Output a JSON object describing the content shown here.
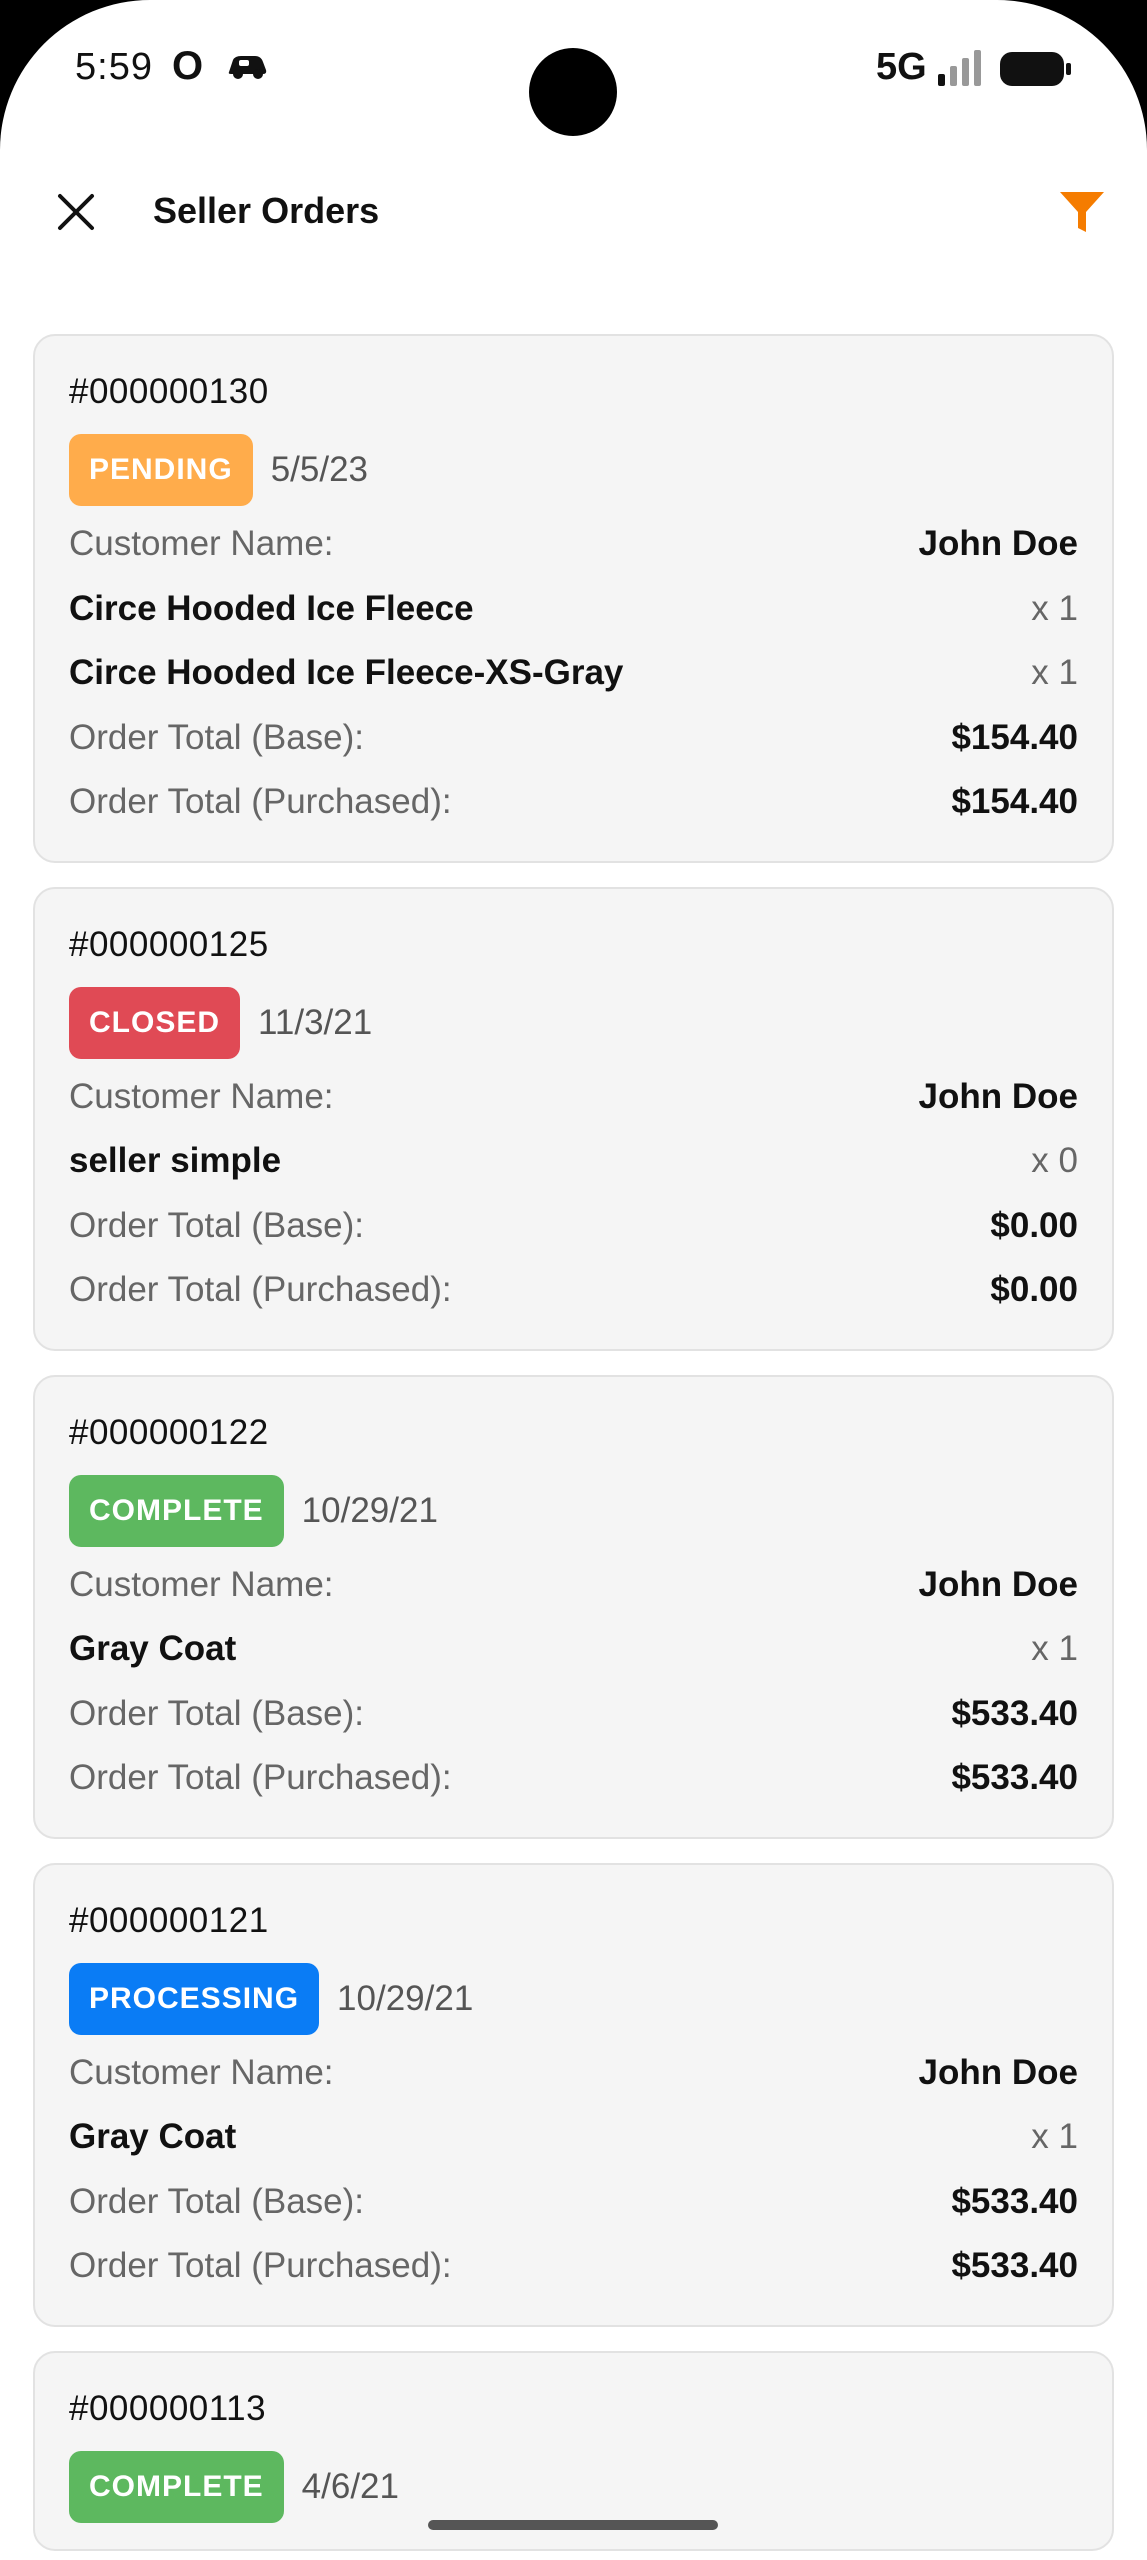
{
  "status_bar": {
    "time": "5:59",
    "app_icon": "O",
    "network": "5G",
    "icons": [
      "car-icon",
      "signal-icon",
      "battery-icon"
    ]
  },
  "app_bar": {
    "title": "Seller Orders",
    "close_icon": "close-icon",
    "filter_icon": "filter-icon",
    "filter_color": "#F57C00"
  },
  "labels": {
    "customer_name": "Customer Name:",
    "total_base": "Order Total (Base):",
    "total_purchased": "Order Total (Purchased):"
  },
  "status_colors": {
    "PENDING": "#FFAC4B",
    "CLOSED": "#E04A55",
    "COMPLETE": "#5DB85F",
    "PROCESSING": "#0A7CF5"
  },
  "orders": [
    {
      "number": "#000000130",
      "status": "PENDING",
      "date": "5/5/23",
      "customer": "John Doe",
      "items": [
        {
          "name": "Circe Hooded Ice Fleece",
          "qty": "x 1"
        },
        {
          "name": "Circe Hooded Ice Fleece-XS-Gray",
          "qty": "x 1"
        }
      ],
      "total_base": "$154.40",
      "total_purchased": "$154.40"
    },
    {
      "number": "#000000125",
      "status": "CLOSED",
      "date": "11/3/21",
      "customer": "John Doe",
      "items": [
        {
          "name": "seller simple",
          "qty": "x 0"
        }
      ],
      "total_base": "$0.00",
      "total_purchased": "$0.00"
    },
    {
      "number": "#000000122",
      "status": "COMPLETE",
      "date": "10/29/21",
      "customer": "John Doe",
      "items": [
        {
          "name": "Gray Coat",
          "qty": "x 1"
        }
      ],
      "total_base": "$533.40",
      "total_purchased": "$533.40"
    },
    {
      "number": "#000000121",
      "status": "PROCESSING",
      "date": "10/29/21",
      "customer": "John Doe",
      "items": [
        {
          "name": "Gray Coat",
          "qty": "x 1"
        }
      ],
      "total_base": "$533.40",
      "total_purchased": "$533.40"
    },
    {
      "number": "#000000113",
      "status": "COMPLETE",
      "date": "4/6/21",
      "customer": "",
      "items": [],
      "total_base": "",
      "total_purchased": ""
    }
  ]
}
